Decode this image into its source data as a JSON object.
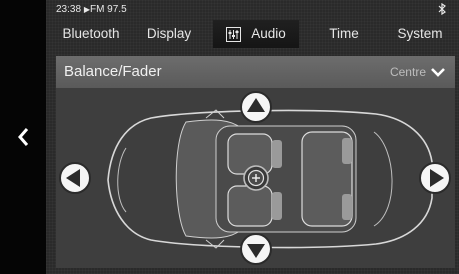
{
  "status": {
    "time": "23:38",
    "source": "FM 97.5",
    "bluetooth_icon": "bluetooth-icon"
  },
  "tabs": [
    {
      "label": "Bluetooth",
      "active": false
    },
    {
      "label": "Display",
      "active": false
    },
    {
      "label": "Audio",
      "active": true,
      "icon": "equalizer-icon"
    },
    {
      "label": "Time",
      "active": false
    },
    {
      "label": "System",
      "active": false
    }
  ],
  "panel": {
    "title": "Balance/Fader",
    "selection": "Centre",
    "selection_icon": "chevron-down-icon"
  },
  "controls": {
    "up": "arrow-up-icon",
    "down": "arrow-down-icon",
    "left": "arrow-left-icon",
    "right": "arrow-right-icon",
    "center": "center-crosshair-icon",
    "back": "back-chevron-icon"
  },
  "colors": {
    "background": "#2a2a2a",
    "panel": "#4d4d4d",
    "header": "#636363",
    "text": "#f0f0f0"
  }
}
